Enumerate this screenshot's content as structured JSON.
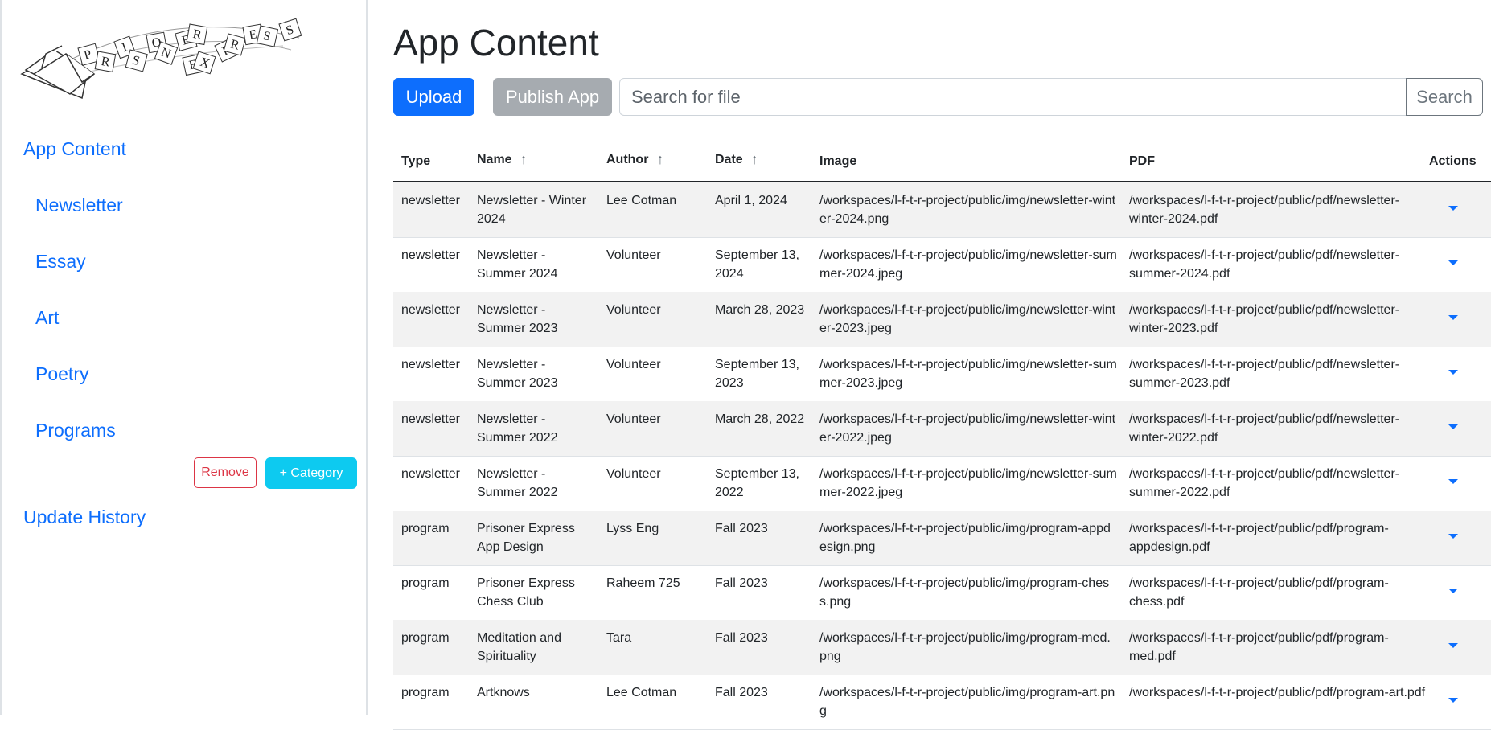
{
  "sidebar": {
    "logo_text": "PRISONER EXPRESS",
    "nav_top": "App Content",
    "categories": [
      "Newsletter",
      "Essay",
      "Art",
      "Poetry",
      "Programs"
    ],
    "remove_label": "Remove",
    "add_category_label": "+ Category",
    "update_history": "Update History"
  },
  "main": {
    "title": "App Content",
    "upload_label": "Upload",
    "publish_label": "Publish App",
    "search_placeholder": "Search for file",
    "search_label": "Search"
  },
  "table": {
    "headers": [
      "Type",
      "Name",
      "Author",
      "Date",
      "Image",
      "PDF",
      "Actions"
    ],
    "sort_icon": "arrow-up-icon",
    "rows": [
      {
        "type": "newsletter",
        "name": "Newsletter - Winter 2024",
        "author": "Lee Cotman",
        "date": "April 1, 2024",
        "image": "/workspaces/l-f-t-r-project/public/img/newsletter-winter-2024.png",
        "pdf": "/workspaces/l-f-t-r-project/public/pdf/newsletter-winter-2024.pdf"
      },
      {
        "type": "newsletter",
        "name": "Newsletter - Summer 2024",
        "author": "Volunteer",
        "date": "September 13, 2024",
        "image": "/workspaces/l-f-t-r-project/public/img/newsletter-summer-2024.jpeg",
        "pdf": "/workspaces/l-f-t-r-project/public/pdf/newsletter-summer-2024.pdf"
      },
      {
        "type": "newsletter",
        "name": "Newsletter - Summer 2023",
        "author": "Volunteer",
        "date": "March 28, 2023",
        "image": "/workspaces/l-f-t-r-project/public/img/newsletter-winter-2023.jpeg",
        "pdf": "/workspaces/l-f-t-r-project/public/pdf/newsletter-winter-2023.pdf"
      },
      {
        "type": "newsletter",
        "name": "Newsletter - Summer 2023",
        "author": "Volunteer",
        "date": "September 13, 2023",
        "image": "/workspaces/l-f-t-r-project/public/img/newsletter-summer-2023.jpeg",
        "pdf": "/workspaces/l-f-t-r-project/public/pdf/newsletter-summer-2023.pdf"
      },
      {
        "type": "newsletter",
        "name": "Newsletter - Summer 2022",
        "author": "Volunteer",
        "date": "March 28, 2022",
        "image": "/workspaces/l-f-t-r-project/public/img/newsletter-winter-2022.jpeg",
        "pdf": "/workspaces/l-f-t-r-project/public/pdf/newsletter-winter-2022.pdf"
      },
      {
        "type": "newsletter",
        "name": "Newsletter - Summer 2022",
        "author": "Volunteer",
        "date": "September 13, 2022",
        "image": "/workspaces/l-f-t-r-project/public/img/newsletter-summer-2022.jpeg",
        "pdf": "/workspaces/l-f-t-r-project/public/pdf/newsletter-summer-2022.pdf"
      },
      {
        "type": "program",
        "name": "Prisoner Express App Design",
        "author": "Lyss Eng",
        "date": "Fall 2023",
        "image": "/workspaces/l-f-t-r-project/public/img/program-appdesign.png",
        "pdf": "/workspaces/l-f-t-r-project/public/pdf/program-appdesign.pdf"
      },
      {
        "type": "program",
        "name": "Prisoner Express Chess Club",
        "author": "Raheem 725",
        "date": "Fall 2023",
        "image": "/workspaces/l-f-t-r-project/public/img/program-chess.png",
        "pdf": "/workspaces/l-f-t-r-project/public/pdf/program-chess.pdf"
      },
      {
        "type": "program",
        "name": "Meditation and Spirituality",
        "author": "Tara",
        "date": "Fall 2023",
        "image": "/workspaces/l-f-t-r-project/public/img/program-med.png",
        "pdf": "/workspaces/l-f-t-r-project/public/pdf/program-med.pdf"
      },
      {
        "type": "program",
        "name": "Artknows",
        "author": "Lee Cotman",
        "date": "Fall 2023",
        "image": "/workspaces/l-f-t-r-project/public/img/program-art.png",
        "pdf": "/workspaces/l-f-t-r-project/public/pdf/program-art.pdf"
      }
    ]
  },
  "colors": {
    "primary": "#0d6efd",
    "info": "#0dcaf0",
    "danger": "#dc3545",
    "secondary": "#6c757d",
    "stripe": "#f2f2f2"
  }
}
